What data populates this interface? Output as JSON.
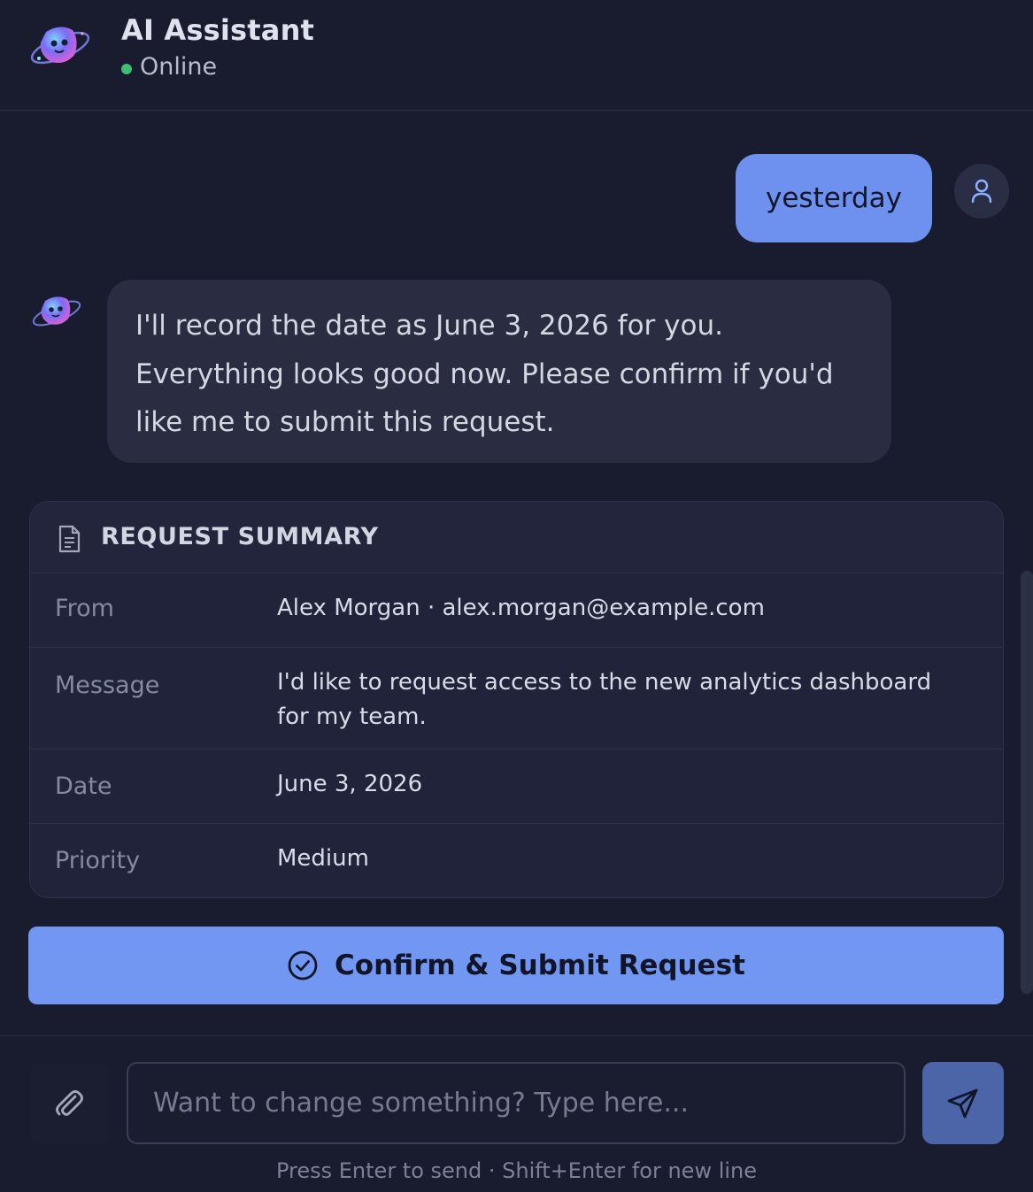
{
  "header": {
    "title": "AI Assistant",
    "status": "Online",
    "status_color": "#3fbf74",
    "logo_icon": "planet-mascot-icon"
  },
  "messages": {
    "user": {
      "text": "yesterday",
      "avatar_icon": "user-icon"
    },
    "assistant": {
      "avatar_icon": "planet-mascot-icon",
      "text": "I'll record the date as June 3, 2026 for you. Everything looks good now. Please confirm if you'd like me to submit this request."
    }
  },
  "summary": {
    "title": "REQUEST SUMMARY",
    "icon": "document-icon",
    "rows": [
      {
        "label": "From",
        "value": "Alex Morgan · alex.morgan@example.com"
      },
      {
        "label": "Message",
        "value": "I'd like to request access to the new analytics dashboard for my team."
      },
      {
        "label": "Date",
        "value": "June 3, 2026"
      },
      {
        "label": "Priority",
        "value": "Medium"
      }
    ]
  },
  "confirm_button": {
    "label": "Confirm & Submit Request",
    "icon": "check-circle-icon"
  },
  "composer": {
    "placeholder": "Want to change something? Type here...",
    "value": "",
    "attach_icon": "paperclip-icon",
    "send_icon": "send-icon",
    "hint": "Press Enter to send · Shift+Enter for new line"
  },
  "colors": {
    "background": "#191c2e",
    "accent": "#7197f3",
    "user_bubble": "#6e90ef",
    "assistant_bubble": "#2a2d42"
  }
}
